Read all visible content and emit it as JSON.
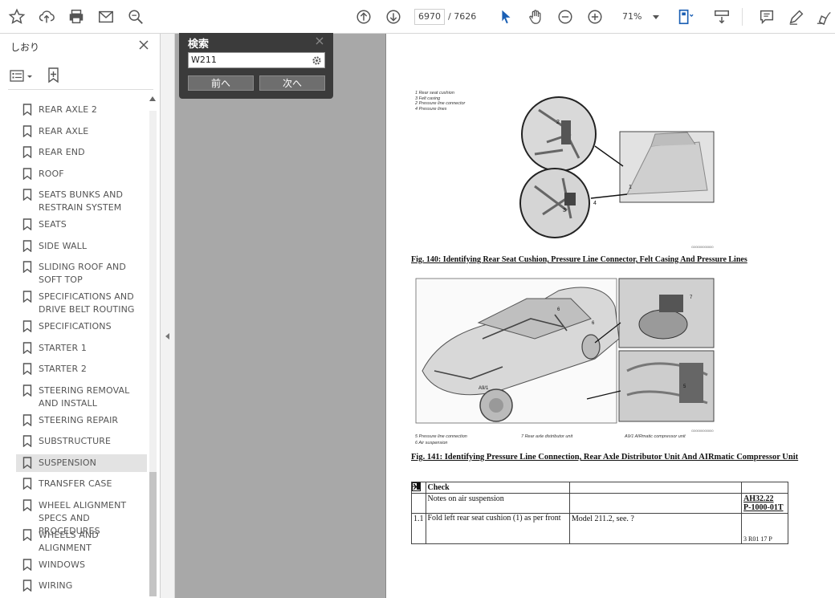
{
  "toolbar": {
    "page_current": "6970",
    "page_total": "/ 7626",
    "zoom": "71%"
  },
  "sidebar": {
    "title": "しおり",
    "bookmarks": [
      {
        "label": "REAR AXLE 2"
      },
      {
        "label": "REAR AXLE"
      },
      {
        "label": "REAR END"
      },
      {
        "label": "ROOF"
      },
      {
        "label": "SEATS BUNKS AND RESTRAIN SYSTEM"
      },
      {
        "label": "SEATS"
      },
      {
        "label": "SIDE WALL"
      },
      {
        "label": "SLIDING ROOF AND SOFT TOP"
      },
      {
        "label": "SPECIFICATIONS AND DRIVE BELT ROUTING"
      },
      {
        "label": "SPECIFICATIONS"
      },
      {
        "label": "STARTER 1"
      },
      {
        "label": "STARTER 2"
      },
      {
        "label": "STEERING REMOVAL AND INSTALL"
      },
      {
        "label": "STEERING REPAIR"
      },
      {
        "label": "SUBSTRUCTURE"
      },
      {
        "label": "SUSPENSION",
        "selected": true
      },
      {
        "label": "TRANSFER CASE"
      },
      {
        "label": "WHEEL ALIGNMENT SPECS AND PROCEDURES"
      },
      {
        "label": "WHEELS AND ALIGNMENT"
      },
      {
        "label": "WINDOWS"
      },
      {
        "label": "WIRING"
      }
    ]
  },
  "search": {
    "title": "検索",
    "query": "W211",
    "prev_label": "前へ",
    "next_label": "次へ"
  },
  "document": {
    "fig140_legend": [
      "1   Rear seat cushion",
      "3   Felt casing",
      "2   Pressure line connector",
      "4   Pressure lines"
    ],
    "fig140_caption": "Fig. 140: Identifying Rear Seat Cushion, Pressure Line Connector, Felt Casing And Pressure Lines",
    "fig140_code": "G00000000000",
    "fig141_legend_1": "5   Pressure line connection",
    "fig141_legend_2": "7   Rear axle distributor unit",
    "fig141_legend_3": "A9/1   AIRmatic compressor unit",
    "fig141_legend_4": "6   Air suspension",
    "fig141_code": "G00000000000",
    "fig141_caption": "Fig. 141: Identifying Pressure Line Connection, Rear Axle Distributor Unit And AIRmatic Compressor Unit",
    "table": {
      "header_label": "Check",
      "row1_text": "Notes on air suspension",
      "row1_ref_1": "AH32.22",
      "row1_ref_2": "P-1000-01T",
      "row2_num": "1.1",
      "row2_text": "Fold left rear seat cushion (1) as per front",
      "row2_model": "Model 211.2, see. ?",
      "row2_ref": "3 R01 17 P"
    }
  }
}
